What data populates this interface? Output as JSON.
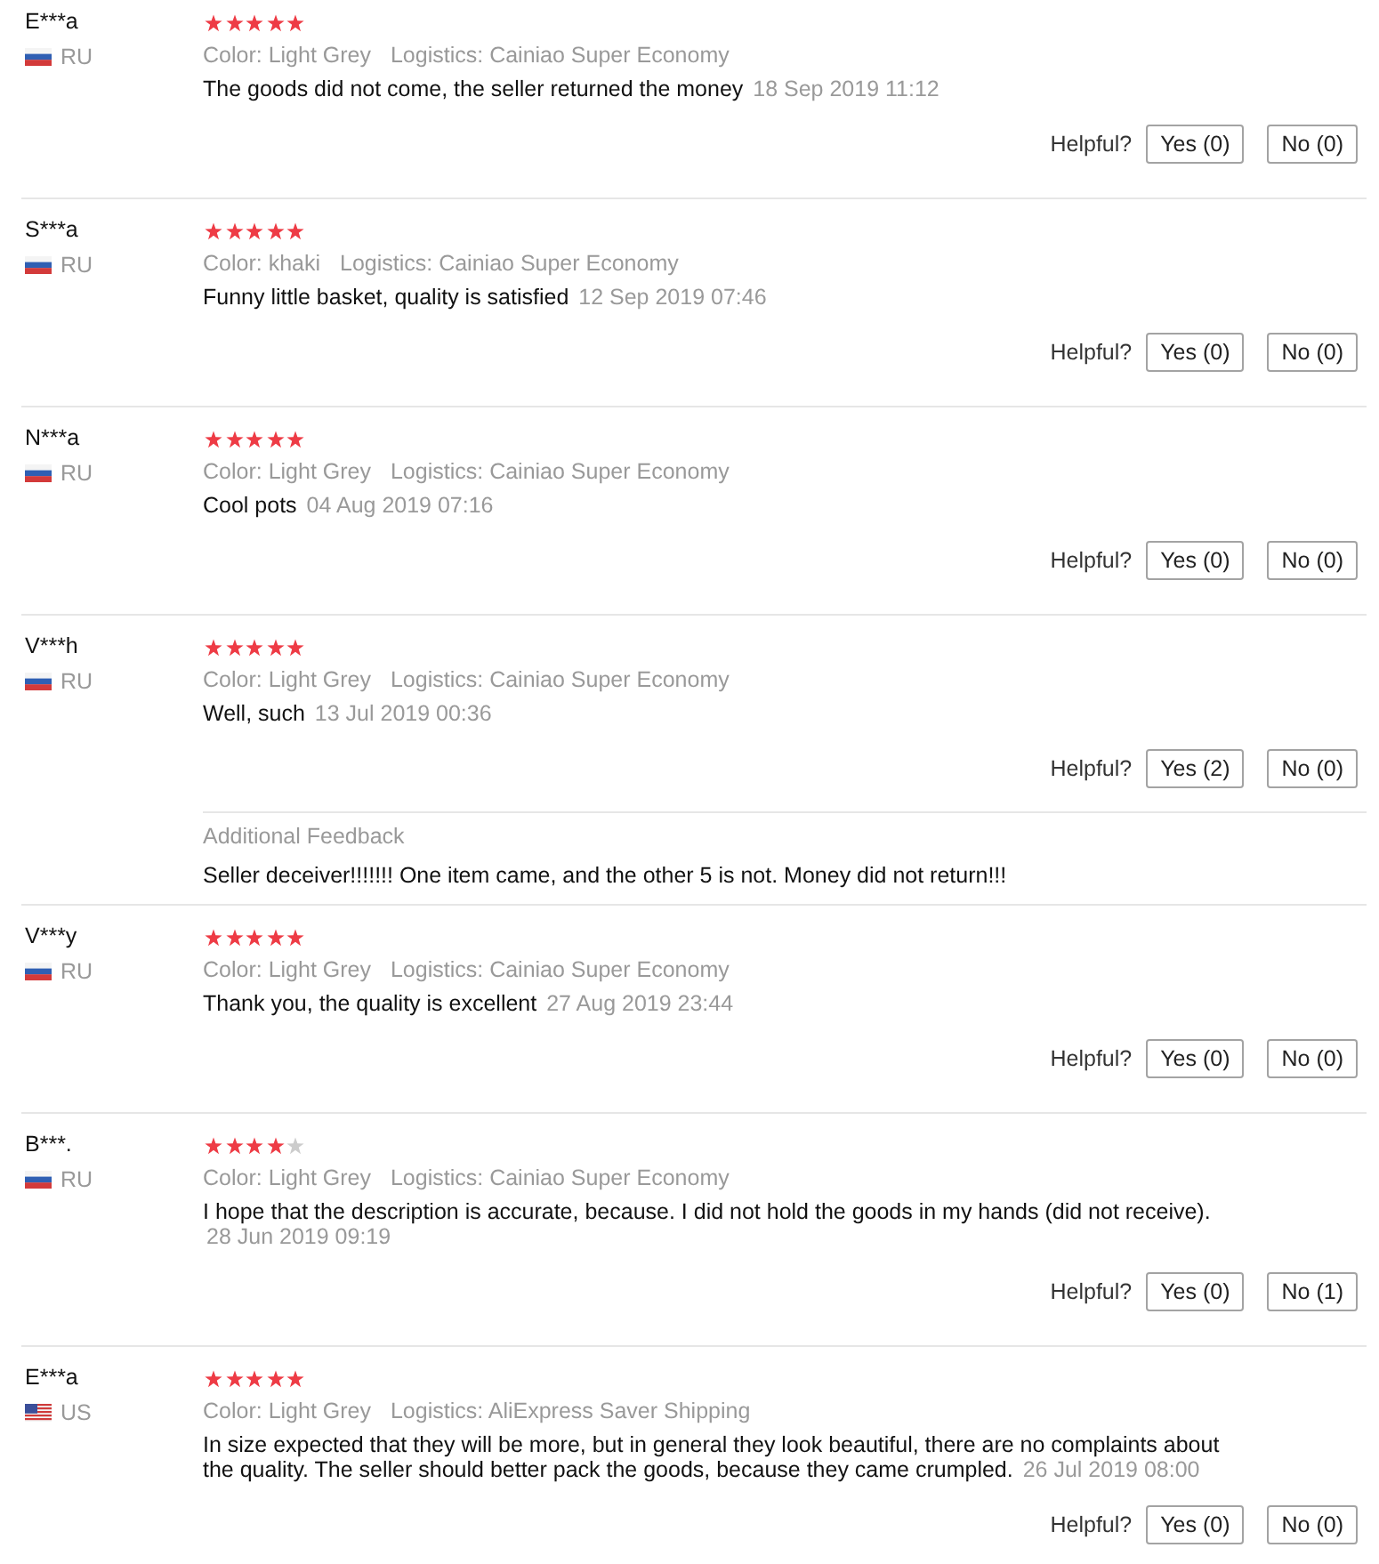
{
  "reviews": [
    {
      "name": "E***a",
      "kind": "ru",
      "country": "RU",
      "stars": 5,
      "attributes": [
        "Color: Light Grey",
        "Logistics: Cainiao Super Economy"
      ],
      "text": "The goods did not come, the seller returned the money",
      "date": "18 Sep 2019 11:12",
      "helpful": {
        "label": "Helpful?",
        "yes": "Yes (0)",
        "no": "No (0)"
      }
    },
    {
      "name": "S***a",
      "kind": "ru",
      "country": "RU",
      "stars": 5,
      "attributes": [
        "Color: khaki",
        "Logistics: Cainiao Super Economy"
      ],
      "text": "Funny little basket, quality is satisfied",
      "date": "12 Sep 2019 07:46",
      "helpful": {
        "label": "Helpful?",
        "yes": "Yes (0)",
        "no": "No (0)"
      }
    },
    {
      "name": "N***a",
      "kind": "ru",
      "country": "RU",
      "stars": 5,
      "attributes": [
        "Color: Light Grey",
        "Logistics: Cainiao Super Economy"
      ],
      "text": "Cool pots",
      "date": "04 Aug 2019 07:16",
      "helpful": {
        "label": "Helpful?",
        "yes": "Yes (0)",
        "no": "No (0)"
      }
    },
    {
      "name": "V***h",
      "kind": "ru",
      "country": "RU",
      "stars": 5,
      "attributes": [
        "Color: Light Grey",
        "Logistics: Cainiao Super Economy"
      ],
      "text": "Well, such",
      "date": "13 Jul 2019 00:36",
      "helpful": {
        "label": "Helpful?",
        "yes": "Yes (2)",
        "no": "No (0)"
      },
      "additional": {
        "label": "Additional Feedback",
        "text": "Seller deceiver!!!!!!! One item came, and the other 5 is not. Money did not return!!!"
      }
    },
    {
      "name": "V***y",
      "kind": "ru",
      "country": "RU",
      "stars": 5,
      "attributes": [
        "Color: Light Grey",
        "Logistics: Cainiao Super Economy"
      ],
      "text": "Thank you, the quality is excellent",
      "date": "27 Aug 2019 23:44",
      "helpful": {
        "label": "Helpful?",
        "yes": "Yes (0)",
        "no": "No (0)"
      }
    },
    {
      "name": "B***.",
      "kind": "ru",
      "country": "RU",
      "stars": 4,
      "attributes": [
        "Color: Light Grey",
        "Logistics: Cainiao Super Economy"
      ],
      "text": "I hope that the description is accurate, because. I did not hold the goods in my hands (did not receive).",
      "date": "28 Jun 2019 09:19",
      "helpful": {
        "label": "Helpful?",
        "yes": "Yes (0)",
        "no": "No (1)"
      }
    },
    {
      "name": "E***a",
      "kind": "us",
      "country": "US",
      "stars": 5,
      "attributes": [
        "Color: Light Grey",
        "Logistics: AliExpress Saver Shipping"
      ],
      "text": "In size expected that they will be more, but in general they look beautiful, there are no complaints about the quality. The seller should better pack the goods, because they came crumpled.",
      "date": "26 Jul 2019 08:00",
      "helpful": {
        "label": "Helpful?",
        "yes": "Yes (0)",
        "no": "No (0)"
      }
    }
  ]
}
